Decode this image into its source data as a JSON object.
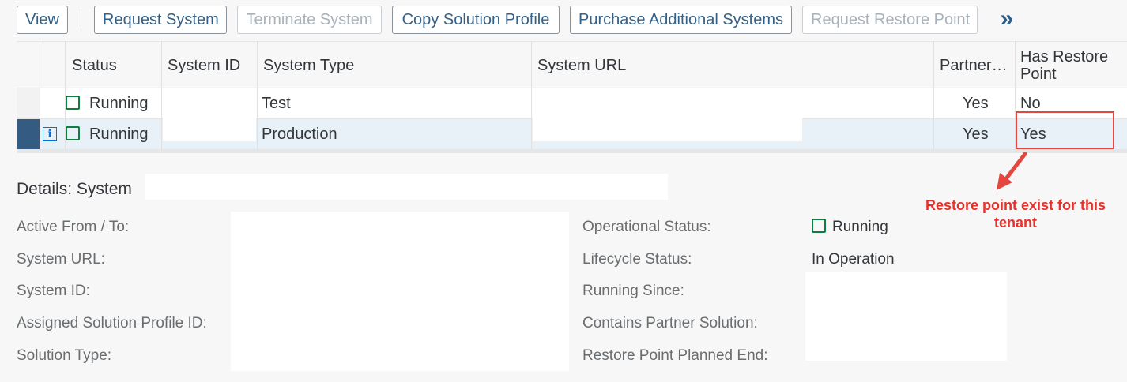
{
  "toolbar": {
    "view": "View",
    "request_system": "Request System",
    "terminate_system": "Terminate System",
    "copy_solution_profile": "Copy Solution Profile",
    "purchase_additional_systems": "Purchase Additional Systems",
    "request_restore_point": "Request Restore Point",
    "overflow": "»"
  },
  "table": {
    "columns": [
      "Status",
      "System ID",
      "System Type",
      "System URL",
      "Partner…",
      "Has Restore Point"
    ],
    "rows": [
      {
        "status": "Running",
        "system_type": "Test",
        "partner": "Yes",
        "has_restore_point": "No"
      },
      {
        "status": "Running",
        "system_type": "Production",
        "partner": "Yes",
        "has_restore_point": "Yes"
      }
    ]
  },
  "details": {
    "title": "Details: System",
    "labels": {
      "active_from_to": "Active From / To:",
      "system_url": "System URL:",
      "system_id": "System ID:",
      "assigned_solution_profile_id": "Assigned Solution Profile ID:",
      "solution_type": "Solution Type:",
      "operational_status": "Operational Status:",
      "lifecycle_status": "Lifecycle Status:",
      "running_since": "Running Since:",
      "contains_partner_solution": "Contains Partner Solution:",
      "restore_point_planned_end": "Restore Point Planned End:"
    },
    "values": {
      "operational_status": "Running",
      "lifecycle_status": "In Operation"
    }
  },
  "annotation": {
    "text": "Restore point exist for this tenant",
    "color": "#e8302a"
  },
  "colors": {
    "link": "#346187",
    "running": "#107e3e",
    "selection": "#345b82"
  }
}
